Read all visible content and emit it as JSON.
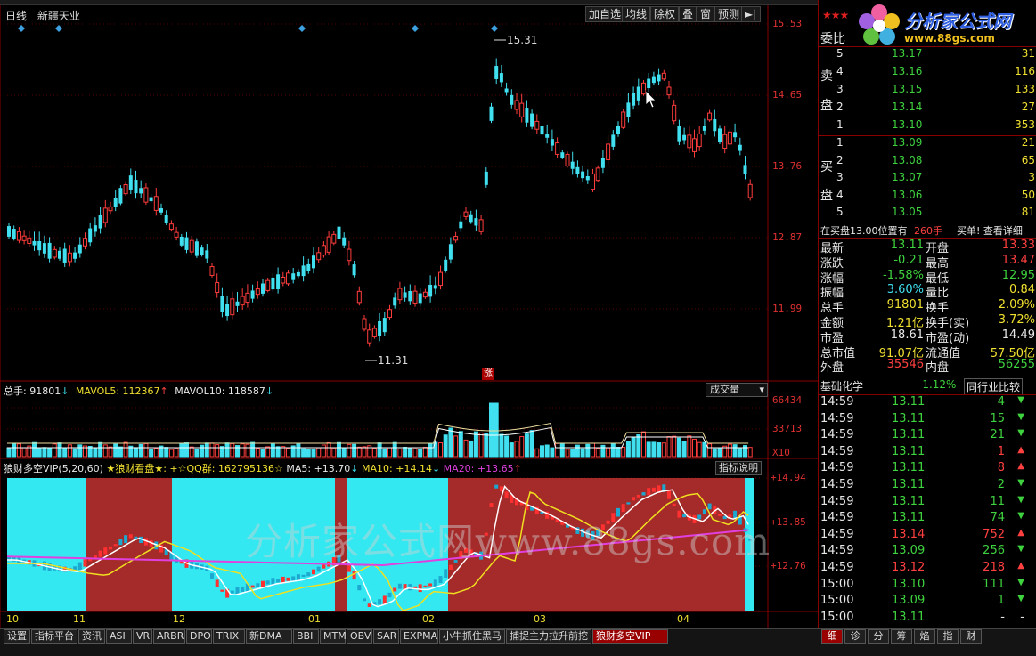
{
  "header": {
    "period": "日线",
    "stock_name": "新疆天业",
    "buttons": [
      "加自选",
      "均线",
      "除权",
      "叠",
      "窗",
      "预测"
    ],
    "arrow_icon": "right-arrow-bar-icon"
  },
  "main_chart": {
    "price_axis": [
      "15.53",
      "14.65",
      "13.76",
      "12.87",
      "11.99"
    ],
    "high_marker": "15.31",
    "low_marker": "11.31",
    "limit_up_badge": "涨"
  },
  "volume_panel": {
    "total_label": "总手: 91801",
    "total_arrow": "↓",
    "mavol5": "MAVOL5: 112367",
    "mavol5_arrow": "↑",
    "mavol10": "MAVOL10: 118587",
    "mavol10_arrow": "↓",
    "dropdown": "成交量",
    "axis": [
      "66434",
      "33713",
      "X10"
    ]
  },
  "indicator_panel": {
    "name": "狼财多空VIP(5,20,60)",
    "star_text": "★狼财看盘★: +☆QQ群: 162795136☆",
    "ma5": "MA5: +13.70",
    "ma5_arrow": "↓",
    "ma10": "MA10: +14.14",
    "ma10_arrow": "↓",
    "ma20": "MA20: +13.65",
    "ma20_arrow": "↑",
    "explain_button": "指标说明",
    "axis": [
      "+14.94",
      "+13.85",
      "+12.76"
    ]
  },
  "date_axis": [
    "10",
    "11",
    "12",
    "01",
    "02",
    "03",
    "04"
  ],
  "watermark": "分析家公式网www.88gs.com",
  "logo": {
    "name": "分析家公式网",
    "url": "www.88gs.com"
  },
  "order_book": {
    "title": "委比",
    "sell_label": [
      "卖",
      "盘"
    ],
    "buy_label": [
      "买",
      "盘"
    ],
    "sell": [
      {
        "level": "5",
        "price": "13.17",
        "vol": "31"
      },
      {
        "level": "4",
        "price": "13.16",
        "vol": "116"
      },
      {
        "level": "3",
        "price": "13.15",
        "vol": "133"
      },
      {
        "level": "2",
        "price": "13.14",
        "vol": "27"
      },
      {
        "level": "1",
        "price": "13.10",
        "vol": "353"
      }
    ],
    "buy": [
      {
        "level": "1",
        "price": "13.09",
        "vol": "21"
      },
      {
        "level": "2",
        "price": "13.08",
        "vol": "65"
      },
      {
        "level": "3",
        "price": "13.07",
        "vol": "3"
      },
      {
        "level": "4",
        "price": "13.06",
        "vol": "50"
      },
      {
        "level": "5",
        "price": "13.05",
        "vol": "81"
      }
    ],
    "notice_text": "在买盘13.00位置有",
    "notice_qty": "260手",
    "notice_link": "买单! 查看详细"
  },
  "quote": [
    {
      "l1": "最新",
      "v1": "13.11",
      "c1": "green",
      "l2": "开盘",
      "v2": "13.33",
      "c2": "red"
    },
    {
      "l1": "涨跌",
      "v1": "-0.21",
      "c1": "green",
      "l2": "最高",
      "v2": "13.47",
      "c2": "red"
    },
    {
      "l1": "涨幅",
      "v1": "-1.58%",
      "c1": "green",
      "l2": "最低",
      "v2": "12.95",
      "c2": "green"
    },
    {
      "l1": "振幅",
      "v1": "3.60%",
      "c1": "cyan",
      "l2": "量比",
      "v2": "0.84",
      "c2": "yellow"
    },
    {
      "l1": "总手",
      "v1": "91801",
      "c1": "yellow",
      "l2": "换手",
      "v2": "2.09%",
      "c2": "yellow"
    },
    {
      "l1": "金额",
      "v1": "1.21亿",
      "c1": "yellow",
      "l2": "换手(实)",
      "v2": "3.72%",
      "c2": "yellow"
    },
    {
      "l1": "市盈",
      "v1": "18.61",
      "c1": "white",
      "l2": "市盈(动)",
      "v2": "14.49",
      "c2": "white"
    },
    {
      "l1": "总市值",
      "v1": "91.07亿",
      "c1": "yellow",
      "l2": "流通值",
      "v2": "57.50亿",
      "c2": "yellow"
    },
    {
      "l1": "外盘",
      "v1": "35546",
      "c1": "red",
      "l2": "内盘",
      "v2": "56255",
      "c2": "green"
    }
  ],
  "sector": {
    "name": "基础化学",
    "change": "-1.12%",
    "compare": "同行业比较"
  },
  "ticks": [
    {
      "time": "14:59",
      "price": "13.11",
      "vol": "4",
      "dir": "down"
    },
    {
      "time": "14:59",
      "price": "13.11",
      "vol": "15",
      "dir": "down"
    },
    {
      "time": "14:59",
      "price": "13.11",
      "vol": "21",
      "dir": "down"
    },
    {
      "time": "14:59",
      "price": "13.11",
      "vol": "1",
      "dir": "up"
    },
    {
      "time": "14:59",
      "price": "13.11",
      "vol": "8",
      "dir": "up"
    },
    {
      "time": "14:59",
      "price": "13.11",
      "vol": "2",
      "dir": "down"
    },
    {
      "time": "14:59",
      "price": "13.11",
      "vol": "11",
      "dir": "down"
    },
    {
      "time": "14:59",
      "price": "13.11",
      "vol": "74",
      "dir": "down"
    },
    {
      "time": "14:59",
      "price": "13.14",
      "vol": "752",
      "dir": "up"
    },
    {
      "time": "14:59",
      "price": "13.09",
      "vol": "256",
      "dir": "down"
    },
    {
      "time": "14:59",
      "price": "13.12",
      "vol": "218",
      "dir": "up"
    },
    {
      "time": "15:00",
      "price": "13.10",
      "vol": "111",
      "dir": "down"
    },
    {
      "time": "15:00",
      "price": "13.09",
      "vol": "1",
      "dir": "down"
    },
    {
      "time": "15:00",
      "price": "13.11",
      "vol": "-",
      "dir": "none"
    }
  ],
  "bottom_tabs": [
    "设置",
    "指标平台",
    "资讯",
    "ASI",
    "VR",
    "ARBR",
    "DPO",
    "TRIX",
    "新DMA",
    "BBI",
    "MTM",
    "OBV",
    "SAR",
    "EXPMA",
    "小牛抓住黑马",
    "捕捉主力拉升前挖",
    "狼财多空VIP"
  ],
  "active_tab": "狼财多空VIP",
  "side_tabs": [
    "细",
    "诊",
    "分",
    "筹",
    "焰",
    "指",
    "财"
  ],
  "colors": {
    "up": "#ff3c3c",
    "down": "#40e0f0",
    "bull_zone": "#a52a2a",
    "bear_zone": "#33e8f0",
    "ma_short": "#ffffff",
    "ma_mid": "#f0e020",
    "ma_long": "#e040e0"
  }
}
